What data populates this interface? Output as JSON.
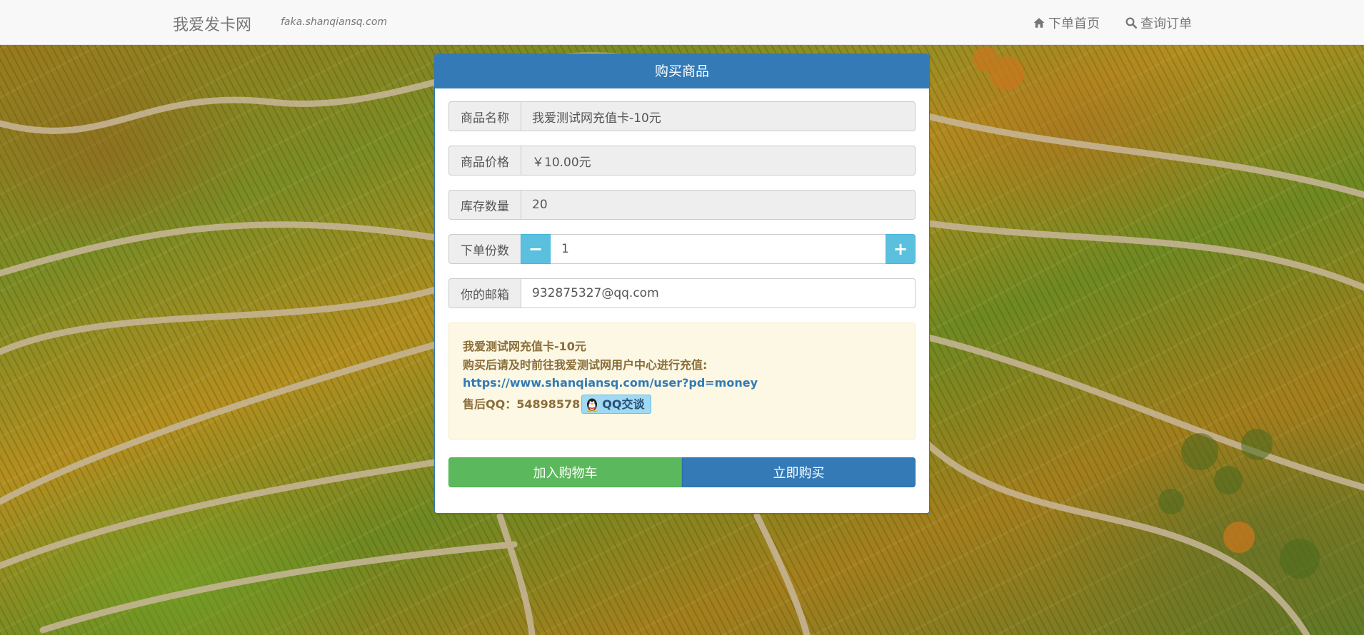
{
  "navbar": {
    "brand": "我爱发卡网",
    "domain": "faka.shanqiansq.com",
    "home_label": "下单首页",
    "query_label": "查询订单"
  },
  "panel": {
    "title": "购买商品",
    "fields": {
      "name_label": "商品名称",
      "name_value": "我爱测试网充值卡-10元",
      "price_label": "商品价格",
      "price_value": "￥10.00元",
      "stock_label": "库存数量",
      "stock_value": "20",
      "qty_label": "下单份数",
      "qty_value": "1",
      "qty_minus": "−",
      "qty_plus": "+",
      "email_label": "你的邮箱",
      "email_value": "932875327@qq.com"
    },
    "notice": {
      "title": "我爱测试网充值卡-10元",
      "instruction": "购买后请及时前往我爱测试网用户中心进行充值:",
      "link": "https://www.shanqiansq.com/user?pd=money",
      "qq_label": "售后QQ：",
      "qq_number": "54898578",
      "qq_button": "QQ交谈"
    },
    "buttons": {
      "cart": "加入购物车",
      "buy": "立即购买"
    }
  },
  "colors": {
    "primary": "#337ab7",
    "success": "#5cb85c",
    "info": "#5bc0de",
    "warning_bg": "#fcf8e3",
    "warning_text": "#8a6d3b"
  }
}
